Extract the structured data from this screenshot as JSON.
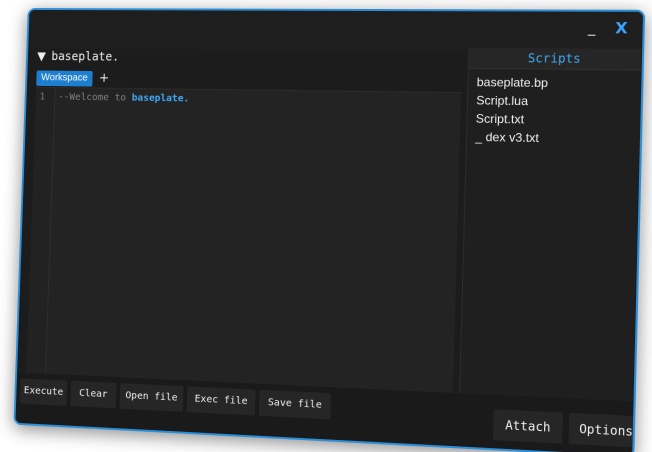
{
  "window": {
    "minimize_label": "_",
    "close_label": "X"
  },
  "header": {
    "caret": "▼",
    "title": "baseplate."
  },
  "tabs": {
    "items": [
      {
        "label": "Workspace"
      }
    ],
    "add_label": "+"
  },
  "editor": {
    "line_number": "1",
    "code_prefix": "--Welcome to ",
    "code_highlight": "baseplate."
  },
  "sidebar": {
    "title": "Scripts",
    "items": [
      {
        "label": "baseplate.bp"
      },
      {
        "label": "Script.lua"
      },
      {
        "label": "Script.txt"
      },
      {
        "label": "_ dex v3.txt"
      }
    ]
  },
  "toolbar": {
    "execute_label": "Execute",
    "clear_label": "Clear",
    "open_file_label": "Open file",
    "exec_file_label": "Exec file",
    "save_file_label": "Save file",
    "attach_label": "Attach",
    "options_label": "Options"
  },
  "colors": {
    "accent": "#2a8fd8",
    "background": "#1c1c1c",
    "highlight": "#3fa9f5"
  }
}
